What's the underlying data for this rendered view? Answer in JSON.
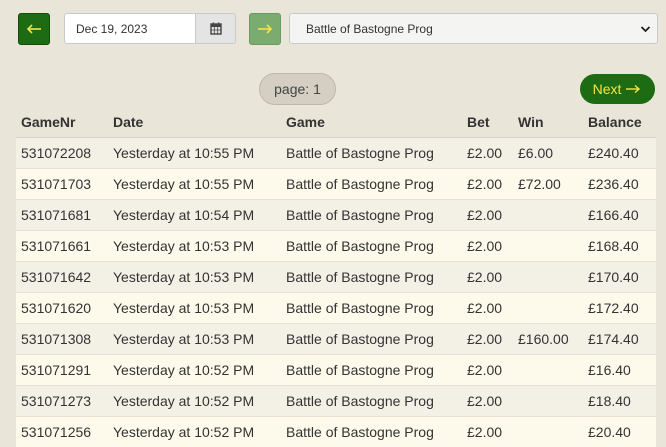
{
  "toolbar": {
    "prev_day_icon": "arrow-left-icon",
    "next_day_icon": "arrow-right-icon",
    "date_value": "Dec 19, 2023",
    "calendar_icon": "calendar-icon",
    "game_selected": "Battle of Bastogne Prog",
    "colors": {
      "prev_button": "#1d6b12",
      "next_day_button": "#7cab6f"
    }
  },
  "pagination": {
    "page_label": "page: 1",
    "next_label": "Next",
    "next_icon": "arrow-right-icon",
    "next_text_color": "#f5e447"
  },
  "table": {
    "headers": [
      "GameNr",
      "Date",
      "Game",
      "Bet",
      "Win",
      "Balance"
    ],
    "rows": [
      [
        "531072208",
        "Yesterday at 10:55 PM",
        "Battle of Bastogne Prog",
        "£2.00",
        "£6.00",
        "£240.40"
      ],
      [
        "531071703",
        "Yesterday at 10:55 PM",
        "Battle of Bastogne Prog",
        "£2.00",
        "£72.00",
        "£236.40"
      ],
      [
        "531071681",
        "Yesterday at 10:54 PM",
        "Battle of Bastogne Prog",
        "£2.00",
        "",
        "£166.40"
      ],
      [
        "531071661",
        "Yesterday at 10:53 PM",
        "Battle of Bastogne Prog",
        "£2.00",
        "",
        "£168.40"
      ],
      [
        "531071642",
        "Yesterday at 10:53 PM",
        "Battle of Bastogne Prog",
        "£2.00",
        "",
        "£170.40"
      ],
      [
        "531071620",
        "Yesterday at 10:53 PM",
        "Battle of Bastogne Prog",
        "£2.00",
        "",
        "£172.40"
      ],
      [
        "531071308",
        "Yesterday at 10:53 PM",
        "Battle of Bastogne Prog",
        "£2.00",
        "£160.00",
        "£174.40"
      ],
      [
        "531071291",
        "Yesterday at 10:52 PM",
        "Battle of Bastogne Prog",
        "£2.00",
        "",
        "£16.40"
      ],
      [
        "531071273",
        "Yesterday at 10:52 PM",
        "Battle of Bastogne Prog",
        "£2.00",
        "",
        "£18.40"
      ],
      [
        "531071256",
        "Yesterday at 10:52 PM",
        "Battle of Bastogne Prog",
        "£2.00",
        "",
        "£20.40"
      ]
    ]
  }
}
